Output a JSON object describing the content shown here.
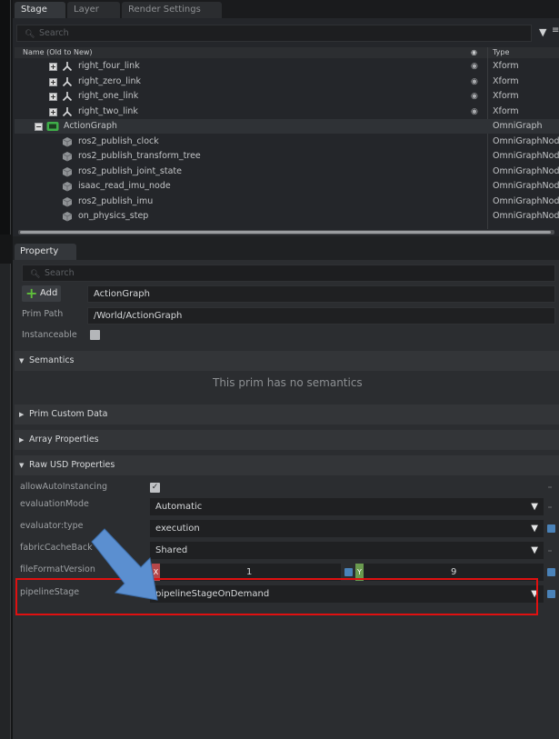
{
  "stage": {
    "tabs": [
      "Stage",
      "Layer",
      "Render Settings"
    ],
    "search_placeholder": "Search",
    "columns": {
      "name": "Name (Old to New)",
      "type": "Type"
    },
    "rows": [
      {
        "label": "right_four_link",
        "type": "Xform",
        "icon": "xform-icon"
      },
      {
        "label": "right_zero_link",
        "type": "Xform",
        "icon": "xform-icon"
      },
      {
        "label": "right_one_link",
        "type": "Xform",
        "icon": "xform-icon"
      },
      {
        "label": "right_two_link",
        "type": "Xform",
        "icon": "xform-icon"
      },
      {
        "label": "ActionGraph",
        "type": "OmniGraph",
        "icon": "omnigraph-icon"
      },
      {
        "label": "ros2_publish_clock",
        "type": "OmniGraphNod",
        "icon": "node-cube-icon"
      },
      {
        "label": "ros2_publish_transform_tree",
        "type": "OmniGraphNod",
        "icon": "node-cube-icon"
      },
      {
        "label": "ros2_publish_joint_state",
        "type": "OmniGraphNod",
        "icon": "node-cube-icon"
      },
      {
        "label": "isaac_read_imu_node",
        "type": "OmniGraphNod",
        "icon": "node-cube-icon"
      },
      {
        "label": "ros2_publish_imu",
        "type": "OmniGraphNod",
        "icon": "node-cube-icon"
      },
      {
        "label": "on_physics_step",
        "type": "OmniGraphNod",
        "icon": "node-cube-icon"
      }
    ]
  },
  "property": {
    "tab": "Property",
    "search_placeholder": "Search",
    "add_label": "Add",
    "prim_name": "ActionGraph",
    "prim_path_label": "Prim Path",
    "prim_path": "/World/ActionGraph",
    "instanceable_label": "Instanceable",
    "sections": {
      "semantics": "Semantics",
      "no_semantics": "This prim has no semantics",
      "custom_data": "Prim Custom Data",
      "array": "Array Properties",
      "raw_usd": "Raw USD Properties"
    },
    "raw": {
      "allow_auto_label": "allowAutoInstancing",
      "eval_mode_label": "evaluationMode",
      "eval_mode_value": "Automatic",
      "evaluator_label": "evaluator:type",
      "evaluator_value": "execution",
      "fabric_label": "fabricCacheBack",
      "fabric_value": "Shared",
      "file_format_label": "fileFormatVersion",
      "x_tag": "X",
      "x_value": "1",
      "y_tag": "Y",
      "y_value": "9",
      "pipeline_label": "pipelineStage",
      "pipeline_value": "pipelineStageOnDemand"
    }
  },
  "colors": {
    "highlight": "#e01010",
    "arrow": "#5b8fd0",
    "x_tag": "#b5474a",
    "y_tag": "#6a9a4f",
    "omnigraph_icon": "#3fae49"
  }
}
